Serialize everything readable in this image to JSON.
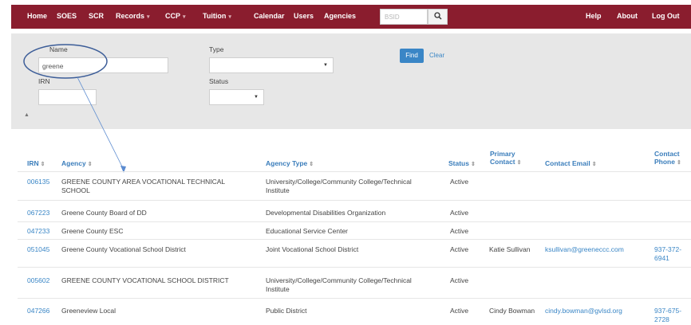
{
  "nav": {
    "home": "Home",
    "soes": "SOES",
    "scr": "SCR",
    "records": "Records",
    "ccp": "CCP",
    "tuition": "Tuition",
    "calendar": "Calendar",
    "users": "Users",
    "agencies": "Agencies",
    "bsid_placeholder": "BSID",
    "help": "Help",
    "about": "About",
    "logout": "Log Out"
  },
  "filters": {
    "name_label": "Name",
    "name_value": "greene",
    "type_label": "Type",
    "type_value": "",
    "irn_label": "IRN",
    "irn_value": "",
    "status_label": "Status",
    "status_value": "",
    "find": "Find",
    "clear": "Clear"
  },
  "table": {
    "headers": {
      "irn": "IRN",
      "agency": "Agency",
      "agency_type": "Agency Type",
      "status": "Status",
      "primary_contact_1": "Primary",
      "primary_contact_2": "Contact",
      "contact_email": "Contact Email",
      "contact_phone_1": "Contact",
      "contact_phone_2": "Phone"
    },
    "rows": [
      {
        "irn": "006135",
        "agency_1": "GREENE COUNTY AREA VOCATIONAL TECHNICAL",
        "agency_2": "SCHOOL",
        "type_1": "University/College/Community College/Technical",
        "type_2": "Institute",
        "status": "Active",
        "contact": "",
        "email": "",
        "phone_1": "",
        "phone_2": ""
      },
      {
        "irn": "067223",
        "agency_1": "Greene County Board of DD",
        "agency_2": "",
        "type_1": "Developmental Disabilities Organization",
        "type_2": "",
        "status": "Active",
        "contact": "",
        "email": "",
        "phone_1": "",
        "phone_2": ""
      },
      {
        "irn": "047233",
        "agency_1": "Greene County ESC",
        "agency_2": "",
        "type_1": "Educational Service Center",
        "type_2": "",
        "status": "Active",
        "contact": "",
        "email": "",
        "phone_1": "",
        "phone_2": ""
      },
      {
        "irn": "051045",
        "agency_1": "Greene County Vocational School District",
        "agency_2": "",
        "type_1": "Joint Vocational School District",
        "type_2": "",
        "status": "Active",
        "contact": "Katie Sullivan",
        "email": "ksullivan@greeneccc.com",
        "phone_1": "937-372-",
        "phone_2": "6941"
      },
      {
        "irn": "005602",
        "agency_1": "GREENE COUNTY VOCATIONAL SCHOOL DISTRICT",
        "agency_2": "",
        "type_1": "University/College/Community College/Technical",
        "type_2": "Institute",
        "status": "Active",
        "contact": "",
        "email": "",
        "phone_1": "",
        "phone_2": ""
      },
      {
        "irn": "047266",
        "agency_1": "Greeneview Local",
        "agency_2": "",
        "type_1": "Public District",
        "type_2": "",
        "status": "Active",
        "contact": "Cindy Bowman",
        "email": "cindy.bowman@gvlsd.org",
        "phone_1": "937-675-",
        "phone_2": "2728"
      }
    ]
  },
  "colors": {
    "nav_bg": "#8a1d2e",
    "link": "#3a86c6",
    "header_link": "#3a7dbb",
    "panel_bg": "#e7e7e7",
    "annotation": "#3c5d98"
  },
  "icons": {
    "search": "magnifier",
    "sort": "up-down-caret",
    "dropdown": "caret-down",
    "collapse": "caret-up"
  }
}
